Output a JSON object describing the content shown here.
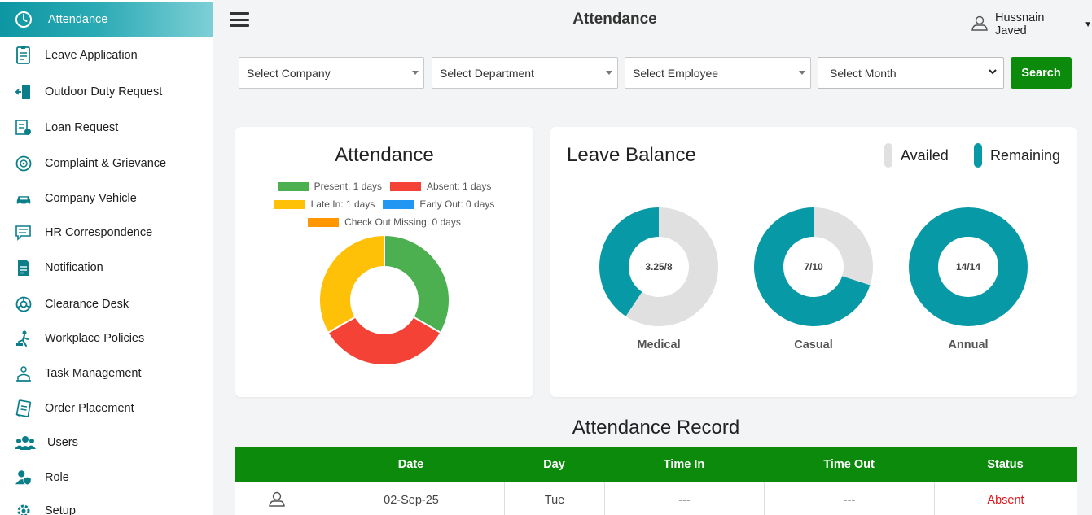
{
  "sidebar": {
    "items": [
      {
        "label": "Attendance",
        "icon": "clock-icon",
        "active": true
      },
      {
        "label": "Leave Application",
        "icon": "document-icon"
      },
      {
        "label": "Outdoor Duty Request",
        "icon": "door-exit-icon"
      },
      {
        "label": "Loan Request",
        "icon": "loan-form-icon"
      },
      {
        "label": "Complaint & Grievance",
        "icon": "complaint-icon"
      },
      {
        "label": "Company Vehicle",
        "icon": "car-icon"
      },
      {
        "label": "HR Correspondence",
        "icon": "chat-icon"
      },
      {
        "label": "Notification",
        "icon": "notification-doc-icon"
      },
      {
        "label": "Clearance Desk",
        "icon": "clearance-icon"
      },
      {
        "label": "Workplace Policies",
        "icon": "policy-icon"
      },
      {
        "label": "Task Management",
        "icon": "task-icon"
      },
      {
        "label": "Order Placement",
        "icon": "order-icon"
      },
      {
        "label": "Users",
        "icon": "users-icon"
      },
      {
        "label": "Role",
        "icon": "role-icon"
      },
      {
        "label": "Setup",
        "icon": "gear-icon"
      }
    ]
  },
  "header": {
    "title": "Attendance",
    "user_name": "Hussnain Javed"
  },
  "filters": {
    "company": "Select Company",
    "department": "Select Department",
    "employee": "Select Employee",
    "month": "Select Month",
    "search_label": "Search"
  },
  "attendance_card": {
    "title": "Attendance",
    "legend": {
      "present": "Present: 1 days",
      "absent": "Absent: 1 days",
      "late_in": "Late In: 1 days",
      "early_out": "Early Out: 0 days",
      "checkout_missing": "Check Out Missing: 0 days"
    }
  },
  "leave_card": {
    "title": "Leave Balance",
    "legend_availed": "Availed",
    "legend_remaining": "Remaining",
    "medical": {
      "label": "Medical",
      "center_text": "3.25/8"
    },
    "casual": {
      "label": "Casual",
      "center_text": "7/10"
    },
    "annual": {
      "label": "Annual",
      "center_text": "14/14"
    }
  },
  "colors": {
    "present": "#4caf50",
    "absent": "#f44336",
    "late_in": "#ffc107",
    "early_out": "#2196f3",
    "checkout_missing": "#ff9800",
    "availed": "#e0e0e0",
    "remaining": "#0899a6",
    "table_header": "#0b8a0b"
  },
  "chart_data": [
    {
      "type": "pie",
      "title": "Attendance",
      "categories": [
        "Present",
        "Absent",
        "Late In",
        "Early Out",
        "Check Out Missing"
      ],
      "values": [
        1,
        1,
        1,
        0,
        0
      ]
    },
    {
      "type": "pie",
      "title": "Leave Balance",
      "series": [
        {
          "name": "Medical",
          "values": [
            4.75,
            3.25
          ]
        },
        {
          "name": "Casual",
          "values": [
            3,
            7
          ]
        },
        {
          "name": "Annual",
          "values": [
            0,
            14
          ]
        }
      ],
      "categories": [
        "Availed",
        "Remaining"
      ]
    }
  ],
  "record": {
    "title": "Attendance Record",
    "columns": [
      "",
      "Date",
      "Day",
      "Time In",
      "Time Out",
      "Status"
    ],
    "rows": [
      {
        "date": "02-Sep-25",
        "day": "Tue",
        "time_in": "---",
        "time_out": "---",
        "status": "Absent"
      }
    ]
  }
}
